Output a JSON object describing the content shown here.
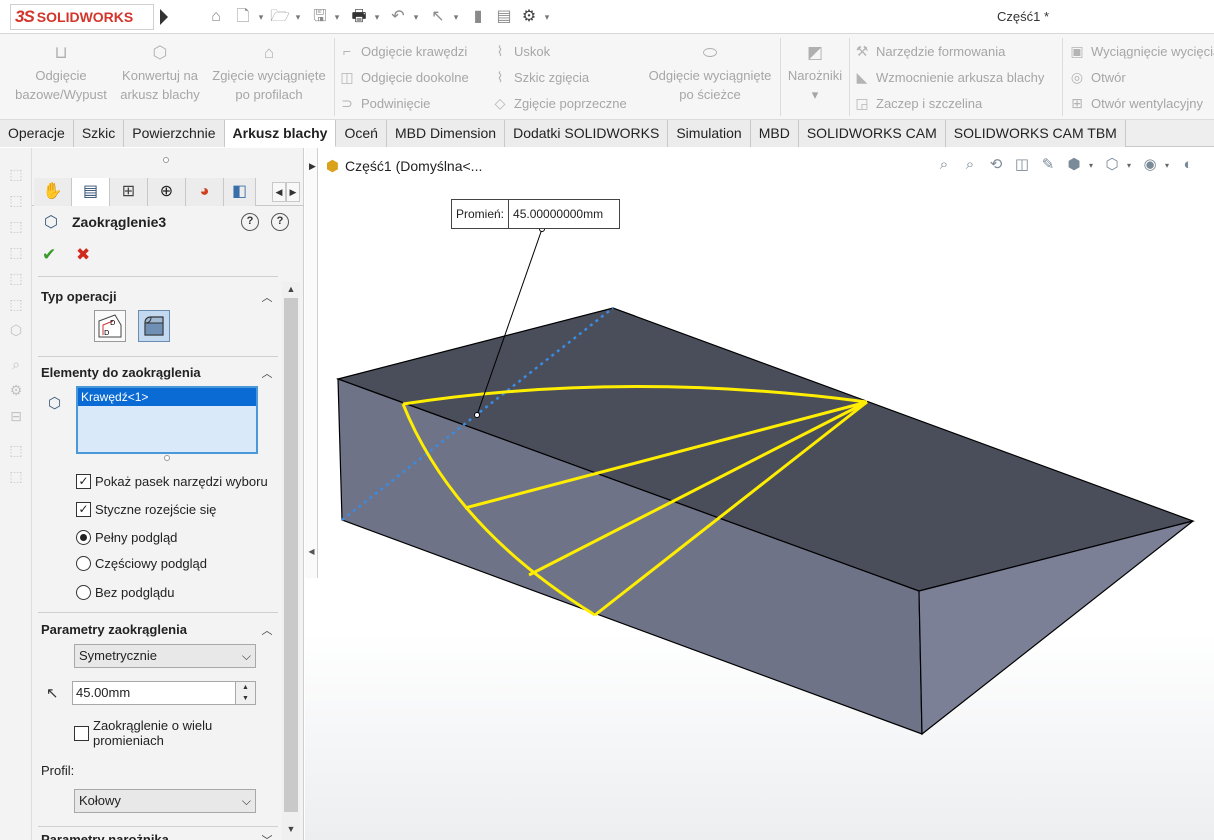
{
  "app": {
    "logo_ds": "3S",
    "logo_text": "SOLIDWORKS",
    "document_title": "Część1 *"
  },
  "ribbon": {
    "big_buttons": [
      {
        "line1": "Odgięcie",
        "line2": "bazowe/Wypust"
      },
      {
        "line1": "Konwertuj na",
        "line2": "arkusz blachy"
      },
      {
        "line1": "Zgięcie wyciągnięte",
        "line2": "po profilach"
      },
      {
        "line1": "Odgięcie wyciągnięte",
        "line2": "po ścieżce"
      },
      {
        "line1": "Narożniki",
        "line2": "▾"
      }
    ],
    "group1": [
      "Odgięcie krawędzi",
      "Odgięcie dookolne",
      "Podwinięcie"
    ],
    "group2": [
      "Uskok",
      "Szkic zgięcia",
      "Zgięcie poprzeczne"
    ],
    "group3": [
      "Narzędzie formowania",
      "Wzmocnienie arkusza blachy",
      "Zaczep i szczelina"
    ],
    "group4": [
      "Wyciągnięcie wycięcia",
      "Otwór",
      "Otwór wentylacyjny"
    ]
  },
  "tabs": [
    {
      "label": "Operacje",
      "active": false
    },
    {
      "label": "Szkic",
      "active": false
    },
    {
      "label": "Powierzchnie",
      "active": false
    },
    {
      "label": "Arkusz blachy",
      "active": true
    },
    {
      "label": "Oceń",
      "active": false
    },
    {
      "label": "MBD Dimension",
      "active": false
    },
    {
      "label": "Dodatki SOLIDWORKS",
      "active": false
    },
    {
      "label": "Simulation",
      "active": false
    },
    {
      "label": "MBD",
      "active": false
    },
    {
      "label": "SOLIDWORKS CAM",
      "active": false
    },
    {
      "label": "SOLIDWORKS CAM TBM",
      "active": false
    }
  ],
  "property_manager": {
    "title": "Zaokrąglenie3",
    "help_what": "?",
    "help": "?",
    "groups": {
      "operation_type": "Typ operacji",
      "items_to_fillet": "Elementy do zaokrąglenia",
      "fillet_params": "Parametry zaokrąglenia",
      "setback_params": "Parametry narożnika"
    },
    "selected_item": "Krawędź<1>",
    "options": {
      "show_toolbar": "Pokaż pasek narzędzi wyboru",
      "tangent_propagation": "Styczne rozejście się",
      "full_preview": "Pełny podgląd",
      "partial_preview": "Częściowy podgląd",
      "no_preview": "Bez podglądu"
    },
    "fillet_method": "Symetrycznie",
    "radius_value": "45.00mm",
    "multi_radius_label": "Zaokrąglenie o wielu promieniach",
    "profile_label": "Profil:",
    "profile_value": "Kołowy"
  },
  "viewport": {
    "tree_root": "Część1  (Domyślna<...",
    "callout_label": "Promień:",
    "callout_value": "45.00000000mm",
    "colors": {
      "model_top": "#4a4d5a",
      "model_front": "#6f7387",
      "model_side": "#7c8096",
      "fillet_preview": "#ffee00",
      "axis": "#3b8be0"
    }
  }
}
